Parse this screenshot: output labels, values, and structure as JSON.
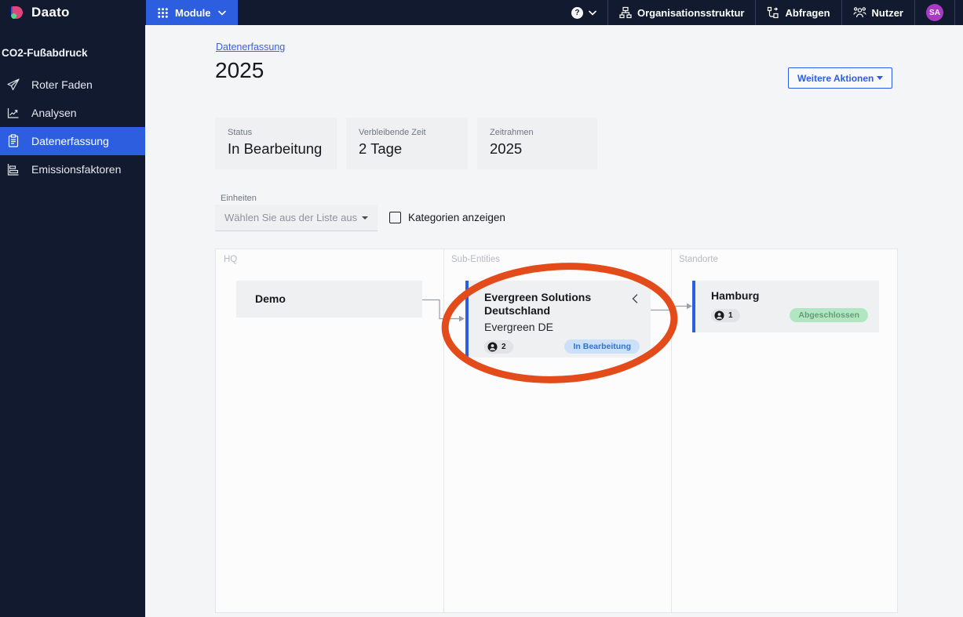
{
  "topnav": {
    "logo_text": "Daato",
    "logo_icon": "daato-logo-icon",
    "module_label": "Module",
    "module_icon": "grid-icon",
    "help_glyph": "?",
    "items": [
      {
        "label": "Organisationsstruktur",
        "icon": "org-structure-icon"
      },
      {
        "label": "Abfragen",
        "icon": "queries-icon"
      },
      {
        "label": "Nutzer",
        "icon": "users-icon"
      }
    ],
    "avatar_initials": "SA",
    "avatar_color": "#a93ac2"
  },
  "sidebar": {
    "section_title": "CO2-Fußabdruck",
    "items": [
      {
        "label": "Roter Faden",
        "icon": "paper-plane-icon",
        "active": false
      },
      {
        "label": "Analysen",
        "icon": "line-chart-icon",
        "active": false
      },
      {
        "label": "Datenerfassung",
        "icon": "clipboard-icon",
        "active": true
      },
      {
        "label": "Emissionsfaktoren",
        "icon": "bar-list-icon",
        "active": false
      }
    ]
  },
  "main": {
    "breadcrumb": "Datenerfassung",
    "title": "2025",
    "actions_button": "Weitere Aktionen",
    "stats": [
      {
        "label": "Status",
        "value": "In Bearbeitung"
      },
      {
        "label": "Verbleibende Zeit",
        "value": "2 Tage"
      },
      {
        "label": "Zeitrahmen",
        "value": "2025"
      }
    ],
    "filters": {
      "units_label": "Einheiten",
      "units_placeholder": "Wählen Sie aus der Liste aus",
      "checkbox_label": "Kategorien anzeigen",
      "checkbox_checked": false
    },
    "orgchart": {
      "columns": [
        {
          "header": "HQ"
        },
        {
          "header": "Sub-Entities"
        },
        {
          "header": "Standorte"
        }
      ],
      "nodes": {
        "demo": {
          "title": "Demo"
        },
        "evergreen": {
          "title": "Evergreen Solutions Deutschland",
          "subtitle": "Evergreen DE",
          "users": "2",
          "status": "In Bearbeitung",
          "status_color": "blue"
        },
        "hamburg": {
          "title": "Hamburg",
          "users": "1",
          "status": "Abgeschlossen",
          "status_color": "green"
        }
      },
      "annotation": {
        "shape": "ellipse",
        "color": "#e44b1a"
      }
    }
  },
  "colors": {
    "navbar_bg": "#111a2e",
    "accent_blue": "#2d5ee0",
    "page_bg": "#f4f5f7",
    "card_bg": "#eff0f2",
    "badge_blue_bg": "#cbe1fa",
    "badge_blue_text": "#3273c5",
    "badge_green_bg": "#b1e7c0",
    "badge_green_text": "#669a79",
    "connector_gray": "#9aa0a8",
    "annotation_red": "#e44b1a"
  }
}
